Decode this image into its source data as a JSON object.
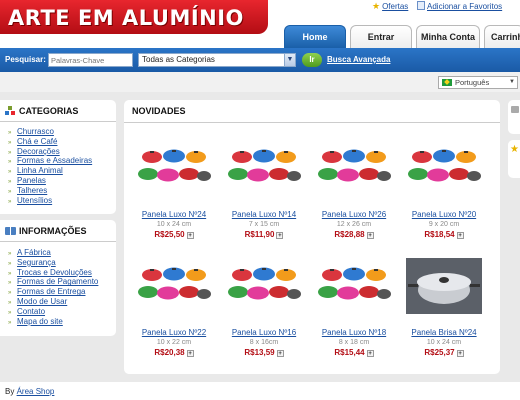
{
  "header": {
    "logo": "ARTE EM ALUMÍNIO",
    "top_links": {
      "offers": "Ofertas",
      "favorites": "Adicionar a Favoritos"
    },
    "tabs": [
      {
        "label": "Home",
        "active": true
      },
      {
        "label": "Entrar",
        "active": false
      },
      {
        "label": "Minha Conta",
        "active": false
      },
      {
        "label": "Carrinho",
        "active": false
      }
    ]
  },
  "search": {
    "label": "Pesquisar:",
    "placeholder": "Palavras-Chave",
    "category_selected": "Todas as Categorias",
    "go_label": "Ir",
    "advanced_label": "Busca Avançada"
  },
  "language": {
    "selected": "Português"
  },
  "sidebar": {
    "categories_title": "CATEGORIAS",
    "categories": [
      "Churrasco",
      "Chá e Café",
      "Decorações",
      "Formas e Assadeiras",
      "Linha Animal",
      "Panelas",
      "Talheres",
      "Utensílios"
    ],
    "info_title": "INFORMAÇÕES",
    "info_links": [
      "A Fábrica",
      "Segurança",
      "Trocas e Devoluções",
      "Formas de Pagamento",
      "Formas de Entrega",
      "Modo de Usar",
      "Contato",
      "Mapa do site"
    ]
  },
  "main": {
    "title": "NOVIDADES",
    "products": [
      {
        "name": "Panela Luxo Nº24",
        "dims": "10 x 24 cm",
        "price": "R$25,50",
        "image": "colored-pots"
      },
      {
        "name": "Panela Luxo Nº14",
        "dims": "7 x 15 cm",
        "price": "R$11,90",
        "image": "colored-pots"
      },
      {
        "name": "Panela Luxo Nº26",
        "dims": "12 x 26 cm",
        "price": "R$28,88",
        "image": "colored-pots"
      },
      {
        "name": "Panela Luxo Nº20",
        "dims": "9 x 20 cm",
        "price": "R$18,54",
        "image": "colored-pots"
      },
      {
        "name": "Panela Luxo Nº22",
        "dims": "10 x 22 cm",
        "price": "R$20,38",
        "image": "colored-pots"
      },
      {
        "name": "Panela Luxo Nº16",
        "dims": "8 x 16cm",
        "price": "R$13,59",
        "image": "colored-pots"
      },
      {
        "name": "Panela Luxo Nº18",
        "dims": "8 x 18 cm",
        "price": "R$15,44",
        "image": "colored-pots"
      },
      {
        "name": "Panela Brisa Nº24",
        "dims": "10 x 24 cm",
        "price": "R$25,37",
        "image": "aluminum-pot"
      }
    ]
  },
  "footer": {
    "prefix": "By",
    "link": "Área Shop"
  },
  "colors": {
    "brand_red": "#c8141c",
    "nav_blue": "#1a5fa8",
    "link_blue": "#1a4fa0",
    "price_red": "#b30d14",
    "go_green": "#5aa824"
  }
}
